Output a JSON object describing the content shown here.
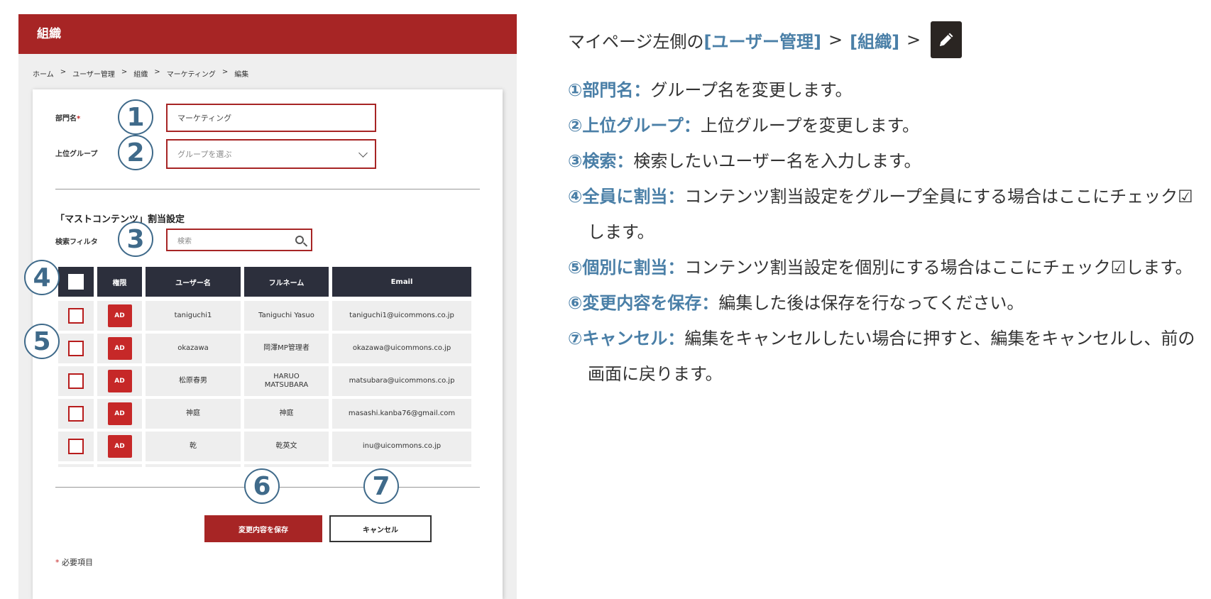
{
  "panel": {
    "title": "組織",
    "breadcrumb": [
      "ホーム",
      "ユーザー管理",
      "組織",
      "マーケティング",
      "編集"
    ],
    "breadcrumb_sep": ">",
    "dept_label": "部門名",
    "required_mark": "*",
    "dept_value": "マーケティング",
    "parent_label": "上位グループ",
    "parent_placeholder": "グループを選ぶ",
    "section_title": "「マストコンテンツ」割当設定",
    "filter_label": "検索フィルタ",
    "search_placeholder": "検索",
    "headers": [
      "権限",
      "ユーザー名",
      "フルネーム",
      "Email"
    ],
    "rows": [
      {
        "role": "AD",
        "username": "taniguchi1",
        "fullname": "Taniguchi Yasuo",
        "email": "taniguchi1@uicommons.co.jp"
      },
      {
        "role": "AD",
        "username": "okazawa",
        "fullname": "岡澤MP管理者",
        "email": "okazawa@uicommons.co.jp"
      },
      {
        "role": "AD",
        "username": "松原春男",
        "fullname": "HARUO MATSUBARA",
        "email": "matsubara@uicommons.co.jp"
      },
      {
        "role": "AD",
        "username": "神庭",
        "fullname": "神庭",
        "email": "masashi.kanba76@gmail.com"
      },
      {
        "role": "AD",
        "username": "乾",
        "fullname": "乾英文",
        "email": "inu@uicommons.co.jp"
      }
    ],
    "save_label": "変更内容を保存",
    "cancel_label": "キャンセル",
    "required_note": "必要項目"
  },
  "markers": [
    "1",
    "2",
    "3",
    "4",
    "5",
    "6",
    "7"
  ],
  "explanation": {
    "intro_prefix": "マイページ左側の",
    "intro_item1": "[ユーザー管理]",
    "intro_item2": "[組織]",
    "gt": ">",
    "items": [
      {
        "key": "①部門名：",
        "text": "グループ名を変更します。"
      },
      {
        "key": "②上位グループ：",
        "text": "上位グループを変更します。"
      },
      {
        "key": "③検索：",
        "text": "検索したいユーザー名を入力します。"
      },
      {
        "key": "④全員に割当：",
        "text": "コンテンツ割当設定をグループ全員にする場合はここにチェック☑します。"
      },
      {
        "key": "⑤個別に割当：",
        "text": "コンテンツ割当設定を個別にする場合はここにチェック☑します。"
      },
      {
        "key": "⑥変更内容を保存：",
        "text": "編集した後は保存を行なってください。"
      },
      {
        "key": "⑦キャンセル：",
        "text": "編集をキャンセルしたい場合に押すと、編集をキャンセルし、前の画面に戻ります。"
      }
    ]
  },
  "colors": {
    "brand": "#a72525",
    "accent": "#4a7fa7",
    "header_dark": "#2c2f3c"
  }
}
